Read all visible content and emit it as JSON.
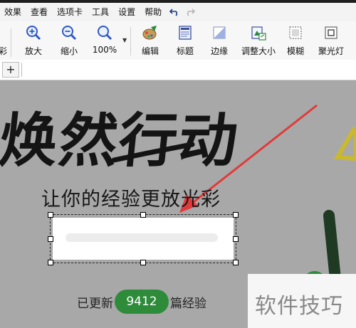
{
  "menu": {
    "items": [
      "效果",
      "查看",
      "选项卡",
      "工具",
      "设置",
      "帮助"
    ]
  },
  "toolbar": {
    "partial_left": "彩",
    "zoom_in": "放大",
    "zoom_out": "缩小",
    "zoom_level": "100%",
    "edit": "编辑",
    "title": "标题",
    "border": "边缘",
    "resize": "调整大小",
    "blur": "模糊",
    "spotlight": "聚光灯"
  },
  "tabs": {
    "add": "+"
  },
  "canvas": {
    "headline": "焕然行动",
    "subline": "让你的经验更放光彩",
    "footer_prefix": "已更新",
    "count": "9412",
    "footer_suffix": "篇经验"
  },
  "watermark": {
    "text": "软件技巧"
  },
  "colors": {
    "arrow": "#e23a3a",
    "pill": "#2e8b3a",
    "canvas_bg": "#a8a8a8"
  },
  "icons": [
    "undo-icon",
    "redo-icon",
    "zoom-in-icon",
    "zoom-out-icon",
    "zoom-fit-icon",
    "edit-icon",
    "title-icon",
    "border-icon",
    "resize-icon",
    "blur-icon",
    "spotlight-icon"
  ]
}
